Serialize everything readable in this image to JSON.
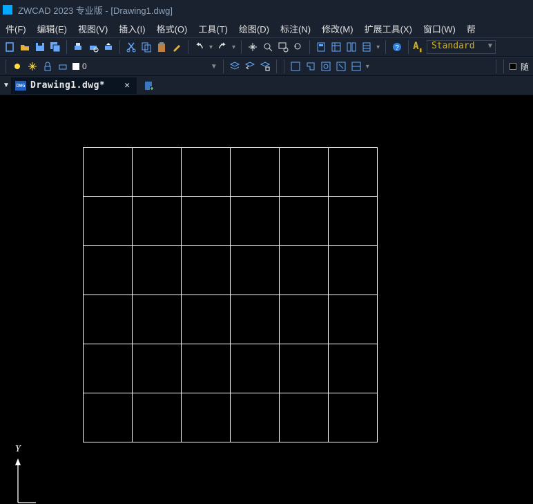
{
  "titlebar": {
    "app_title": "ZWCAD 2023 专业版 - [Drawing1.dwg]"
  },
  "menubar": {
    "items": [
      {
        "label": "件(F)"
      },
      {
        "label": "编辑(E)"
      },
      {
        "label": "视图(V)"
      },
      {
        "label": "插入(I)"
      },
      {
        "label": "格式(O)"
      },
      {
        "label": "工具(T)"
      },
      {
        "label": "绘图(D)"
      },
      {
        "label": "标注(N)"
      },
      {
        "label": "修改(M)"
      },
      {
        "label": "扩展工具(X)"
      },
      {
        "label": "窗口(W)"
      },
      {
        "label": "帮"
      }
    ]
  },
  "toolbar1": {
    "style_prefix": "A",
    "style_value": "Standard"
  },
  "toolbar2": {
    "layer_number": "0",
    "right_label": "随"
  },
  "tabbar": {
    "file_tab_label": "Drawing1.dwg*",
    "file_icon_text": "DWG"
  },
  "drawing": {
    "grid_rows": 6,
    "grid_cols": 6
  },
  "ucs": {
    "y_label": "Y"
  }
}
